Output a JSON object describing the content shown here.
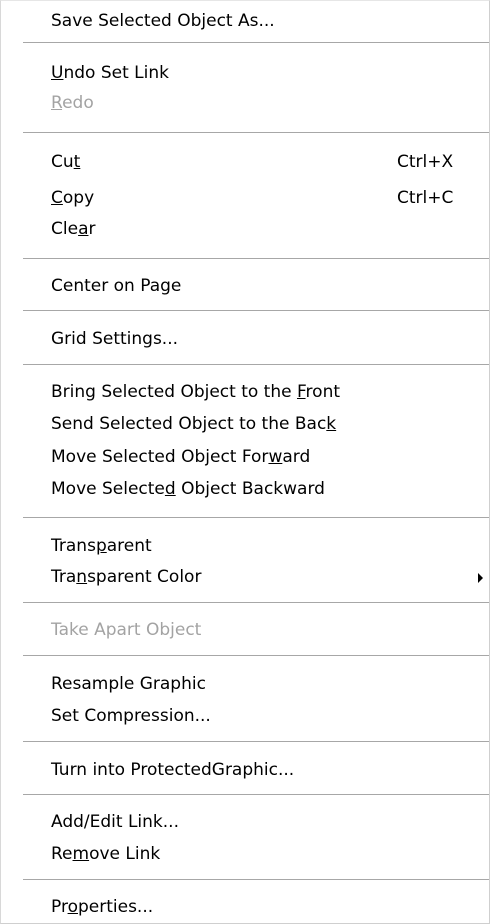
{
  "menu": {
    "items": [
      {
        "id": "save-selected-object-as",
        "label": "Save Selected Object As...",
        "shortcut": "",
        "enabled": true,
        "has_submenu": false,
        "mnemonic": ""
      },
      {
        "id": "undo-set-link",
        "label": "Undo Set Link",
        "shortcut": "",
        "enabled": true,
        "has_submenu": false,
        "mnemonic": "U"
      },
      {
        "id": "redo",
        "label": "Redo",
        "shortcut": "",
        "enabled": false,
        "has_submenu": false,
        "mnemonic": "R"
      },
      {
        "id": "cut",
        "label": "Cut",
        "shortcut": "Ctrl+X",
        "enabled": true,
        "has_submenu": false,
        "mnemonic": "t"
      },
      {
        "id": "copy",
        "label": "Copy",
        "shortcut": "Ctrl+C",
        "enabled": true,
        "has_submenu": false,
        "mnemonic": "C"
      },
      {
        "id": "clear",
        "label": "Clear",
        "shortcut": "",
        "enabled": true,
        "has_submenu": false,
        "mnemonic": "a"
      },
      {
        "id": "center-on-page",
        "label": "Center on Page",
        "shortcut": "",
        "enabled": true,
        "has_submenu": false,
        "mnemonic": ""
      },
      {
        "id": "grid-settings",
        "label": "Grid Settings...",
        "shortcut": "",
        "enabled": true,
        "has_submenu": false,
        "mnemonic": ""
      },
      {
        "id": "bring-to-front",
        "label": "Bring Selected Object to the Front",
        "shortcut": "",
        "enabled": true,
        "has_submenu": false,
        "mnemonic": "F"
      },
      {
        "id": "send-to-back",
        "label": "Send Selected Object to the Back",
        "shortcut": "",
        "enabled": true,
        "has_submenu": false,
        "mnemonic": "k"
      },
      {
        "id": "move-forward",
        "label": "Move Selected Object Forward",
        "shortcut": "",
        "enabled": true,
        "has_submenu": false,
        "mnemonic": "w"
      },
      {
        "id": "move-backward",
        "label": "Move Selected Object Backward",
        "shortcut": "",
        "enabled": true,
        "has_submenu": false,
        "mnemonic": "d"
      },
      {
        "id": "transparent",
        "label": "Transparent",
        "shortcut": "",
        "enabled": true,
        "has_submenu": false,
        "mnemonic": "p"
      },
      {
        "id": "transparent-color",
        "label": "Transparent Color",
        "shortcut": "",
        "enabled": true,
        "has_submenu": true,
        "mnemonic": "n"
      },
      {
        "id": "take-apart-object",
        "label": "Take Apart Object",
        "shortcut": "",
        "enabled": false,
        "has_submenu": false,
        "mnemonic": ""
      },
      {
        "id": "resample-graphic",
        "label": "Resample Graphic",
        "shortcut": "",
        "enabled": true,
        "has_submenu": false,
        "mnemonic": ""
      },
      {
        "id": "set-compression",
        "label": "Set Compression...",
        "shortcut": "",
        "enabled": true,
        "has_submenu": false,
        "mnemonic": ""
      },
      {
        "id": "turn-into-protected-graphic",
        "label": "Turn into ProtectedGraphic...",
        "shortcut": "",
        "enabled": true,
        "has_submenu": false,
        "mnemonic": ""
      },
      {
        "id": "add-edit-link",
        "label": "Add/Edit Link...",
        "shortcut": "",
        "enabled": true,
        "has_submenu": false,
        "mnemonic": ""
      },
      {
        "id": "remove-link",
        "label": "Remove Link",
        "shortcut": "",
        "enabled": true,
        "has_submenu": false,
        "mnemonic": "m"
      },
      {
        "id": "properties",
        "label": "Properties...",
        "shortcut": "",
        "enabled": true,
        "has_submenu": false,
        "mnemonic": "o"
      }
    ]
  },
  "colors": {
    "menu_background": "#ffffff",
    "text": "#000000",
    "disabled_text": "#a3a3a3",
    "separator": "#a7a7a7"
  }
}
